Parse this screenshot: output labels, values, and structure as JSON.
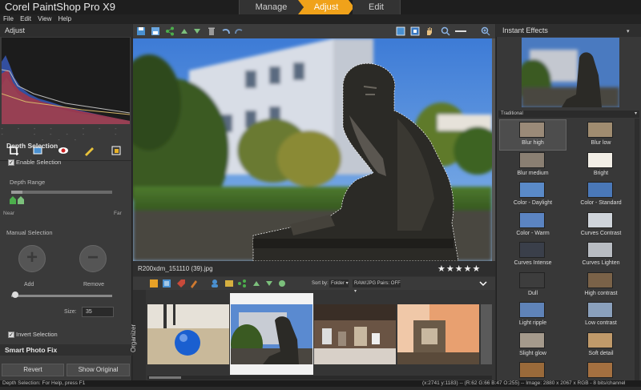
{
  "app": {
    "title": "Corel PaintShop Pro X9"
  },
  "tabs": {
    "manage": "Manage",
    "adjust": "Adjust",
    "edit": "Edit"
  },
  "menu": {
    "file": "File",
    "edit": "Edit",
    "view": "View",
    "help": "Help"
  },
  "left_panel": {
    "header": "Adjust",
    "hist_dashes": "---- ---- ---- ----",
    "depth_title": "Depth Selection",
    "enable_selection": "Enable Selection",
    "depth_range": "Depth Range",
    "near": "Near",
    "far": "Far",
    "manual_selection": "Manual Selection",
    "add": "Add",
    "remove": "Remove",
    "size_label": "Size:",
    "size_value": "35",
    "invert_selection": "Invert Selection",
    "smart_photo_fix": "Smart Photo Fix",
    "revert": "Revert",
    "show_original": "Show Original",
    "plus": "+",
    "minus": "−",
    "check": "✓"
  },
  "center": {
    "filename": "R200xdm_151110 (39).jpg",
    "stars": "★★★★★",
    "rating": 5,
    "sort_by": "Sort by:",
    "folder": "Folder ▾",
    "raw_pairs": "RAW/JPG Pairs: OFF ▾",
    "organizer": "Organizer"
  },
  "right_panel": {
    "header": "Instant Effects",
    "traditional": "Traditional",
    "effects": [
      {
        "label": "Blur high",
        "color": "#9a8a78"
      },
      {
        "label": "Blur low",
        "color": "#a08c70"
      },
      {
        "label": "Blur medium",
        "color": "#8a7f72"
      },
      {
        "label": "Bright",
        "color": "#f2eee6"
      },
      {
        "label": "Color - Daylight",
        "color": "#5a8ac8"
      },
      {
        "label": "Color - Standard",
        "color": "#4a78b8"
      },
      {
        "label": "Color - Warm",
        "color": "#5b84c2"
      },
      {
        "label": "Curves Contrast",
        "color": "#cfd4da"
      },
      {
        "label": "Curves Intense",
        "color": "#3a3f4a"
      },
      {
        "label": "Curves Lighten",
        "color": "#b8bcc2"
      },
      {
        "label": "Dull",
        "color": "#3d3d3d"
      },
      {
        "label": "High contrast",
        "color": "#7a6248"
      },
      {
        "label": "Light ripple",
        "color": "#5f83b8"
      },
      {
        "label": "Low contrast",
        "color": "#8aa0bc"
      },
      {
        "label": "Slight glow",
        "color": "#a59a8c"
      },
      {
        "label": "Soft detail",
        "color": "#c09a6a"
      },
      {
        "label": "",
        "color": "#9a6a3a"
      },
      {
        "label": "",
        "color": "#a47040"
      }
    ]
  },
  "status": {
    "left": "Depth Selection: For Help, press F1",
    "right": "(x:2741 y:1183) -- (R:62 G:66 B:47 O:255) -- Image: 2880 x 2067 x RGB - 8 bits/channel"
  },
  "colors": {
    "accent": "#f0a21a",
    "selection_green": "#4cae4c"
  }
}
